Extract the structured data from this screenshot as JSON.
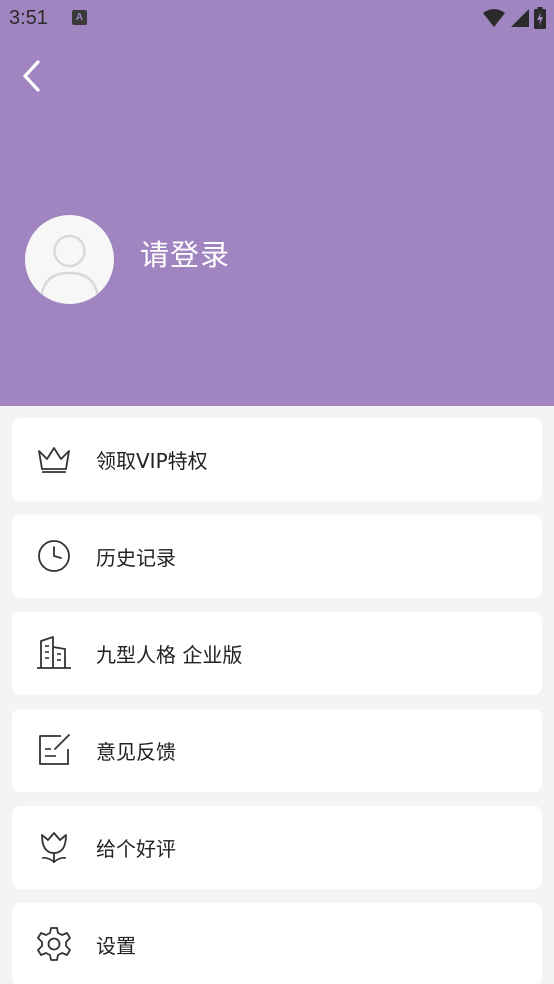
{
  "status_bar": {
    "time": "3:51",
    "app_icon_letter": "A",
    "icons": [
      "wifi-icon",
      "signal-icon",
      "battery-charging-icon"
    ]
  },
  "header": {
    "background": "#a085c0",
    "back_icon": "chevron-left-icon",
    "avatar_icon": "user-avatar-icon",
    "login_label": "请登录"
  },
  "menu": {
    "items": [
      {
        "label": "领取VIP特权",
        "icon": "crown-icon"
      },
      {
        "label": "历史记录",
        "icon": "clock-icon"
      },
      {
        "label": "九型人格 企业版",
        "icon": "building-icon"
      },
      {
        "label": "意见反馈",
        "icon": "feedback-edit-icon"
      },
      {
        "label": "给个好评",
        "icon": "tulip-icon"
      },
      {
        "label": "设置",
        "icon": "gear-icon"
      }
    ]
  }
}
